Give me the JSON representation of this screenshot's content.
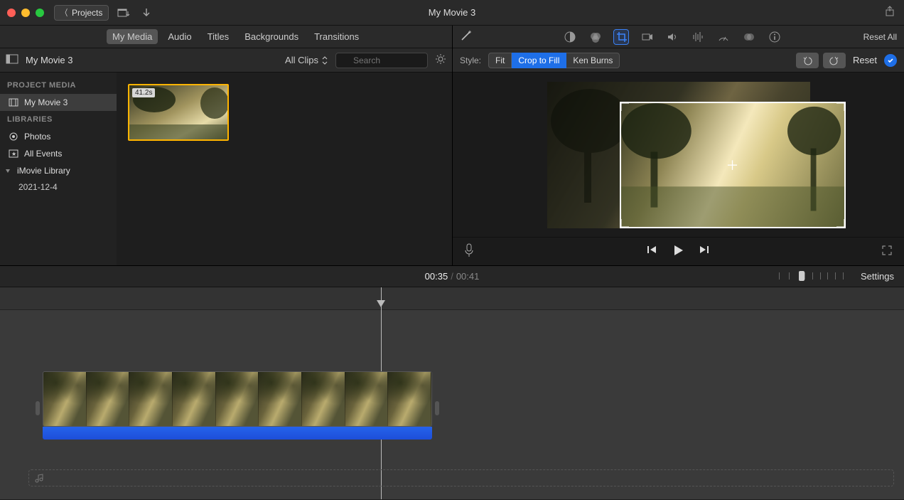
{
  "titlebar": {
    "projects_button": "Projects",
    "title": "My Movie 3"
  },
  "nav_tabs": {
    "my_media": "My Media",
    "audio": "Audio",
    "titles": "Titles",
    "backgrounds": "Backgrounds",
    "transitions": "Transitions"
  },
  "browser_header": {
    "movie_name": "My Movie 3",
    "all_clips": "All Clips",
    "search_placeholder": "Search"
  },
  "sidebar": {
    "project_media_heading": "PROJECT MEDIA",
    "project_item": "My Movie 3",
    "libraries_heading": "LIBRARIES",
    "photos": "Photos",
    "all_events": "All Events",
    "imovie_library": "iMovie Library",
    "library_date": "2021-12-4"
  },
  "clip": {
    "duration": "41.2s"
  },
  "inspector": {
    "reset_all": "Reset All",
    "style_label": "Style:",
    "fit": "Fit",
    "crop_to_fill": "Crop to Fill",
    "ken_burns": "Ken Burns",
    "reset": "Reset"
  },
  "timecode": {
    "current": "00:35",
    "total": "00:41",
    "settings": "Settings"
  }
}
